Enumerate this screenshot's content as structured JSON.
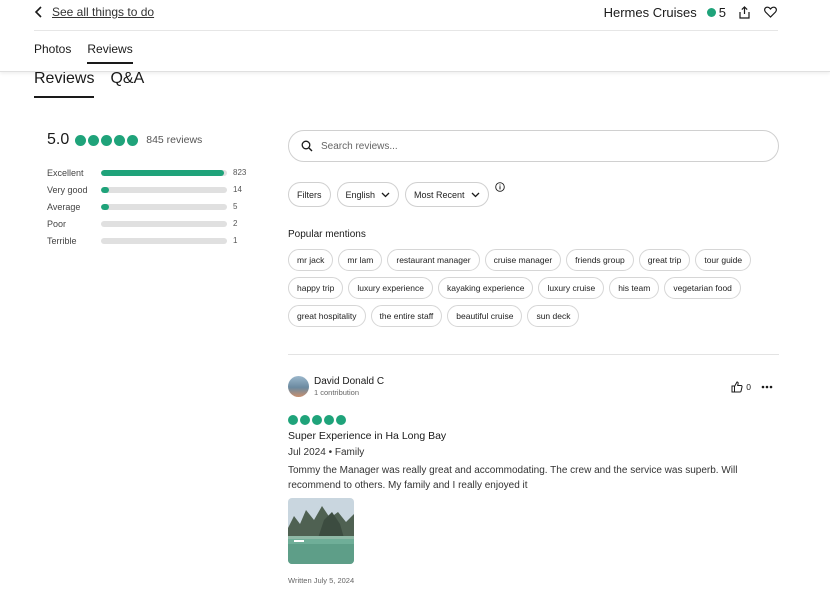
{
  "header": {
    "back_label": "See all things to do",
    "brand_name": "Hermes Cruises",
    "brand_rating": "5",
    "subtabs": [
      {
        "label": "Photos"
      },
      {
        "label": "Reviews"
      }
    ]
  },
  "tabs": [
    {
      "label": "Reviews"
    },
    {
      "label": "Q&A"
    }
  ],
  "summary": {
    "score": "5.0",
    "review_count": "845 reviews",
    "bars": [
      {
        "label": "Excellent",
        "count": "823",
        "fraction": 0.974
      },
      {
        "label": "Very good",
        "count": "14",
        "fraction": 0.06
      },
      {
        "label": "Average",
        "count": "5",
        "fraction": 0.05
      },
      {
        "label": "Poor",
        "count": "2",
        "fraction": 0
      },
      {
        "label": "Terrible",
        "count": "1",
        "fraction": 0
      }
    ]
  },
  "search": {
    "placeholder": "Search reviews..."
  },
  "filters": {
    "filters_label": "Filters",
    "language": "English",
    "sort": "Most Recent"
  },
  "popular": {
    "title": "Popular mentions",
    "items": [
      "mr jack",
      "mr lam",
      "restaurant manager",
      "cruise manager",
      "friends group",
      "great trip",
      "tour guide",
      "happy trip",
      "luxury experience",
      "kayaking experience",
      "luxury cruise",
      "his team",
      "vegetarian food",
      "great hospitality",
      "the entire staff",
      "beautiful cruise",
      "sun deck"
    ]
  },
  "review": {
    "user": "David Donald C",
    "contributions": "1 contribution",
    "helpful_count": "0",
    "title": "Super Experience in Ha Long Bay",
    "meta": "Jul 2024 • Family",
    "body": "Tommy the Manager was really great and accommodating. The crew and the service was superb. Will recommend to others. My family and I really enjoyed it",
    "written": "Written July 5, 2024"
  },
  "colors": {
    "accent": "#1fa37a",
    "track": "#e0e0e0"
  }
}
